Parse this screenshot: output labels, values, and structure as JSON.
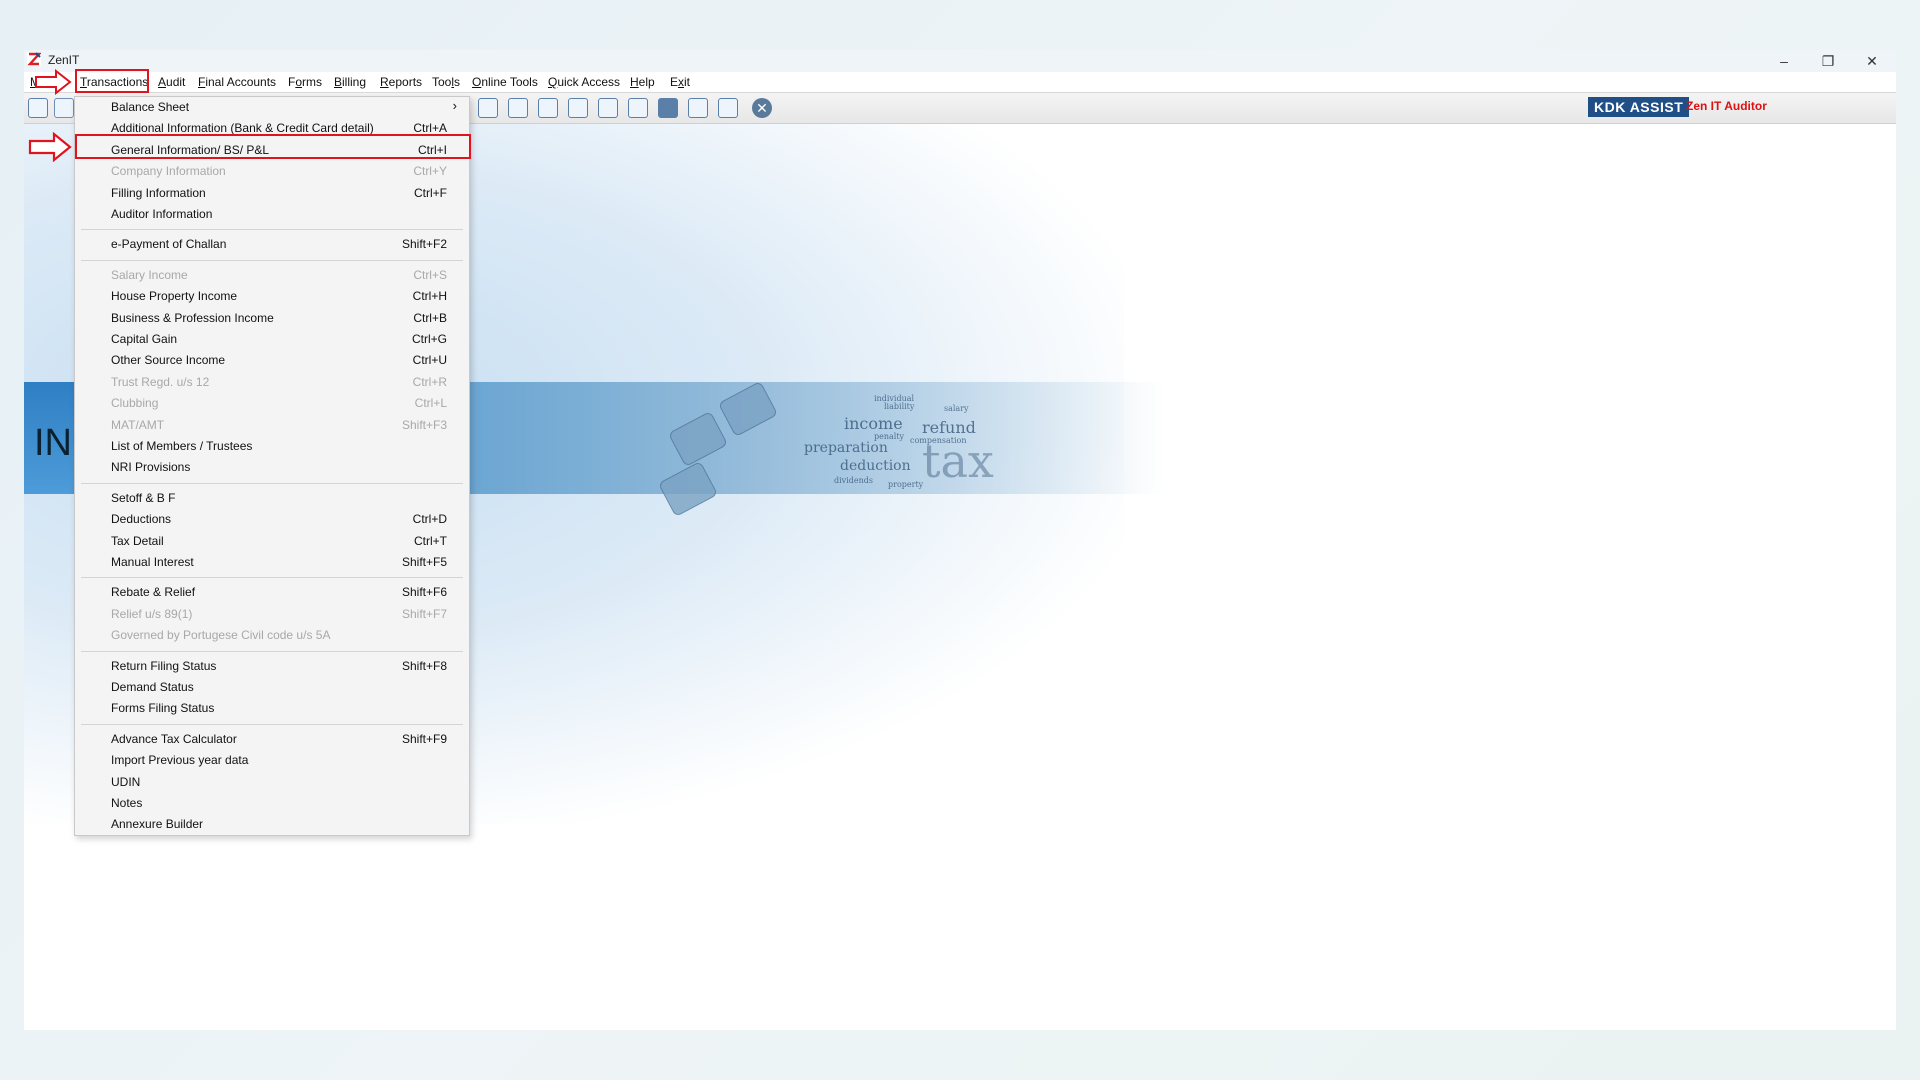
{
  "app": {
    "title": "ZenIT"
  },
  "window_controls": {
    "minimize": "–",
    "restore": "❐",
    "close": "✕"
  },
  "menubar": [
    {
      "label": "Master",
      "underline": "M"
    },
    {
      "label": "Transactions",
      "underline": "T"
    },
    {
      "label": "Audit",
      "underline": "A"
    },
    {
      "label": "Final Accounts",
      "underline": "F"
    },
    {
      "label": "Forms",
      "underline": "o"
    },
    {
      "label": "Billing",
      "underline": "B"
    },
    {
      "label": "Reports",
      "underline": "R"
    },
    {
      "label": "Tools",
      "underline": "l"
    },
    {
      "label": "Online Tools",
      "underline": "O"
    },
    {
      "label": "Quick Access",
      "underline": "Q"
    },
    {
      "label": "Help",
      "underline": "H"
    },
    {
      "label": "Exit",
      "underline": "x"
    }
  ],
  "branding": {
    "kdk_assist": "KDK ASSIST",
    "zen_auditor": "Zen IT Auditor"
  },
  "banner": {
    "text": "INC"
  },
  "wordcloud": [
    "income",
    "refund",
    "preparation",
    "deduction",
    "tax",
    "penalty",
    "liability",
    "individual",
    "compensation",
    "dividends",
    "salary",
    "property"
  ],
  "menu": {
    "items": [
      {
        "label": "Balance Sheet",
        "shortcut": "",
        "disabled": false,
        "submenu": true
      },
      {
        "label": "Additional Information (Bank & Credit Card detail)",
        "shortcut": "Ctrl+A",
        "disabled": false
      },
      {
        "label": "General Information/ BS/ P&L",
        "shortcut": "Ctrl+I",
        "disabled": false,
        "highlighted": true
      },
      {
        "label": "Company Information",
        "shortcut": "Ctrl+Y",
        "disabled": true
      },
      {
        "label": "Filling Information",
        "shortcut": "Ctrl+F",
        "disabled": false
      },
      {
        "label": "Auditor Information",
        "shortcut": "",
        "disabled": false
      },
      {
        "separator": true
      },
      {
        "label": "e-Payment of Challan",
        "shortcut": "Shift+F2",
        "disabled": false
      },
      {
        "separator": true
      },
      {
        "label": "Salary Income",
        "shortcut": "Ctrl+S",
        "disabled": true
      },
      {
        "label": "House Property Income",
        "shortcut": "Ctrl+H",
        "disabled": false
      },
      {
        "label": "Business & Profession Income",
        "shortcut": "Ctrl+B",
        "disabled": false
      },
      {
        "label": "Capital Gain",
        "shortcut": "Ctrl+G",
        "disabled": false
      },
      {
        "label": "Other Source Income",
        "shortcut": "Ctrl+U",
        "disabled": false
      },
      {
        "label": "Trust Regd. u/s 12",
        "shortcut": "Ctrl+R",
        "disabled": true
      },
      {
        "label": "Clubbing",
        "shortcut": "Ctrl+L",
        "disabled": true
      },
      {
        "label": "MAT/AMT",
        "shortcut": "Shift+F3",
        "disabled": true
      },
      {
        "label": "List of Members / Trustees",
        "shortcut": "",
        "disabled": false
      },
      {
        "label": "NRI Provisions",
        "shortcut": "",
        "disabled": false
      },
      {
        "separator": true
      },
      {
        "label": "Setoff & B F",
        "shortcut": "",
        "disabled": false
      },
      {
        "label": "Deductions",
        "shortcut": "Ctrl+D",
        "disabled": false
      },
      {
        "label": "Tax Detail",
        "shortcut": "Ctrl+T",
        "disabled": false
      },
      {
        "label": "Manual Interest",
        "shortcut": "Shift+F5",
        "disabled": false
      },
      {
        "separator": true
      },
      {
        "label": "Rebate & Relief",
        "shortcut": "Shift+F6",
        "disabled": false
      },
      {
        "label": "Relief u/s 89(1)",
        "shortcut": "Shift+F7",
        "disabled": true
      },
      {
        "label": "Governed by Portugese Civil code u/s 5A",
        "shortcut": "",
        "disabled": true
      },
      {
        "separator": true
      },
      {
        "label": "Return Filing Status",
        "shortcut": "Shift+F8",
        "disabled": false
      },
      {
        "label": "Demand Status",
        "shortcut": "",
        "disabled": false
      },
      {
        "label": "Forms Filing Status",
        "shortcut": "",
        "disabled": false
      },
      {
        "separator": true
      },
      {
        "label": "Advance Tax Calculator",
        "shortcut": "Shift+F9",
        "disabled": false
      },
      {
        "label": "Import Previous year data",
        "shortcut": "",
        "disabled": false
      },
      {
        "label": "UDIN",
        "shortcut": "",
        "disabled": false
      },
      {
        "label": "Notes",
        "shortcut": "",
        "disabled": false
      },
      {
        "label": "Annexure Builder",
        "shortcut": "",
        "disabled": false
      }
    ]
  },
  "colors": {
    "annotation_red": "#e0141e",
    "kdk_blue": "#1f4f86",
    "disabled_text": "#a8a8a8"
  }
}
